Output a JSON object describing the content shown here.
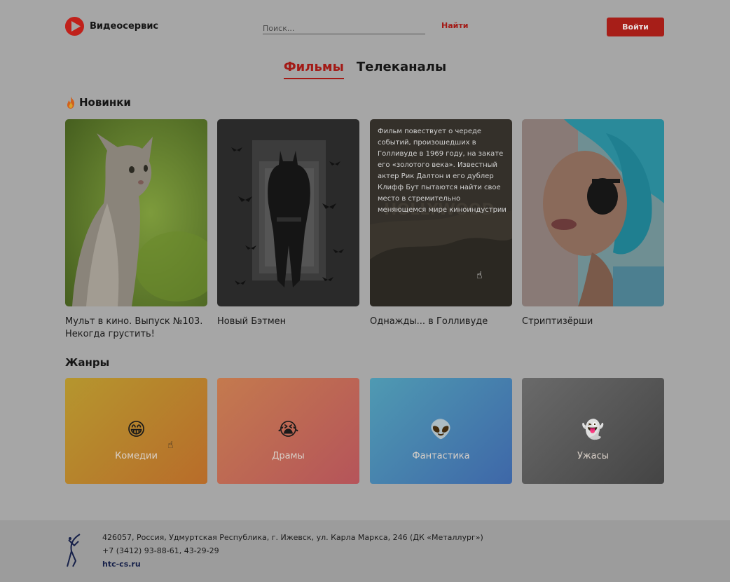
{
  "header": {
    "brand": "Видеосервис",
    "search_placeholder": "Поиск...",
    "find_label": "Найти",
    "login_label": "Войти",
    "accent_color": "#a31a16"
  },
  "tabs": [
    {
      "label": "Фильмы",
      "active": true
    },
    {
      "label": "Телеканалы",
      "active": false
    }
  ],
  "new_section": {
    "icon": "fire-icon",
    "title": "Новинки",
    "movies": [
      {
        "title": "Мульт в кино. Выпуск №103. Некогда грустить!",
        "poster": "cat"
      },
      {
        "title": "Новый Бэтмен",
        "poster": "batman"
      },
      {
        "title": "Однажды... в Голливуде",
        "poster": "hollywood",
        "description": "Фильм повествует о череде событий, произошедших в Голливуде в 1969 году, на закате его «золотого века». Известный актер Рик Далтон и его дублер Клифф Бут пытаются найти свое место в стремительно меняющемся мире киноиндустрии"
      },
      {
        "title": "Стриптизёрши",
        "poster": "woman"
      }
    ]
  },
  "genres_section": {
    "title": "Жанры",
    "genres": [
      {
        "label": "Комедии",
        "icon": "😁",
        "icon_name": "grinning-face-icon",
        "from": "#b5962e",
        "to": "#b86c2a"
      },
      {
        "label": "Драмы",
        "icon": "😭",
        "icon_name": "crying-face-icon",
        "from": "#c47a4e",
        "to": "#b5545a"
      },
      {
        "label": "Фантастика",
        "icon": "👽",
        "icon_name": "alien-icon",
        "from": "#4f9ab2",
        "to": "#3e67a8"
      },
      {
        "label": "Ужасы",
        "icon": "👻",
        "icon_name": "ghost-icon",
        "from": "#6a6a6a",
        "to": "#444444"
      }
    ]
  },
  "footer": {
    "address": "426057, Россия, Удмуртская Республика, г. Ижевск, ул. Карла Маркса, 246 (ДК «Металлург»)",
    "phones": "+7 (3412) 93-88-61, 43-29-29",
    "site": "htc-cs.ru"
  }
}
